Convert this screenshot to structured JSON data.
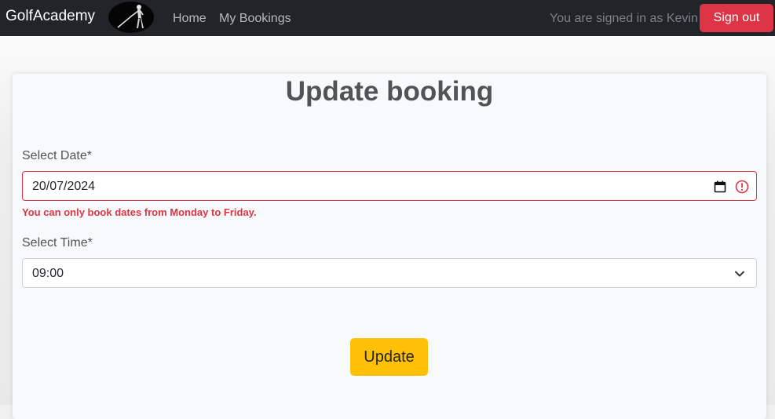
{
  "navbar": {
    "brand": "GolfAcademy",
    "logo_icon": "golfer-silhouette-icon",
    "links": [
      "Home",
      "My Bookings"
    ],
    "signed_in_text": "You are signed in as Kevin",
    "signout_label": "Sign out"
  },
  "form": {
    "title": "Update booking",
    "date_label": "Select Date*",
    "date_value": "20/07/2024",
    "date_error": "You can only book dates from Monday to Friday.",
    "time_label": "Select Time*",
    "time_value": "09:00",
    "submit_label": "Update"
  },
  "icons": {
    "calendar": "calendar-icon",
    "error": "error-circle-icon",
    "dropdown": "chevron-down-icon"
  },
  "colors": {
    "navbar_bg": "#212529",
    "danger": "#dc3545",
    "warning": "#ffc107",
    "card_bg": "#f8f9fa"
  }
}
